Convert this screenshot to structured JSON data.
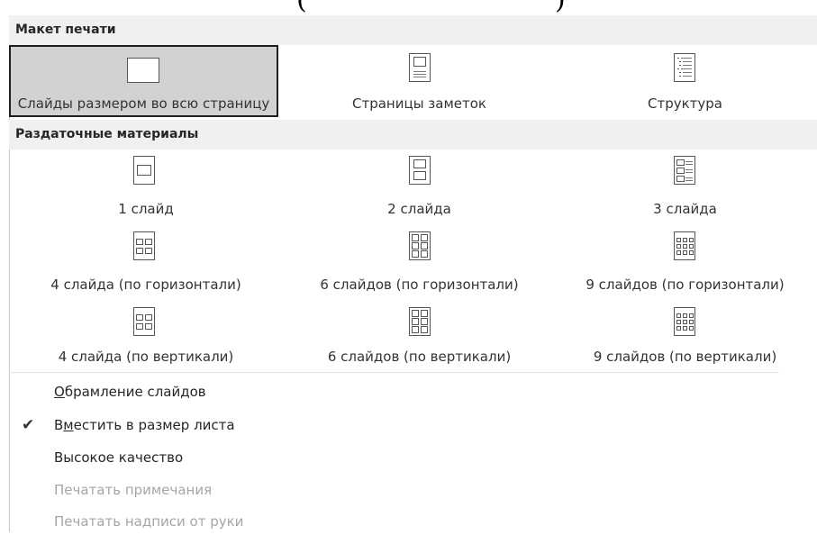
{
  "top_fragment": {
    "left_paren": "(",
    "right_paren": ")"
  },
  "print_layout": {
    "header": "Макет печати",
    "options": [
      {
        "label": "Слайды размером во всю страницу",
        "icon": "full-page-slide-icon",
        "selected": true
      },
      {
        "label": "Страницы заметок",
        "icon": "notes-page-icon",
        "selected": false
      },
      {
        "label": "Структура",
        "icon": "outline-icon",
        "selected": false
      }
    ]
  },
  "handouts": {
    "header": "Раздаточные материалы",
    "options": [
      {
        "label": "1 слайд",
        "icon": "handout-1-slide-icon"
      },
      {
        "label": "2 слайда",
        "icon": "handout-2-slides-icon"
      },
      {
        "label": "3 слайда",
        "icon": "handout-3-slides-icon"
      },
      {
        "label": "4 слайда (по горизонтали)",
        "icon": "handout-4-horizontal-icon"
      },
      {
        "label": "6 слайдов (по горизонтали)",
        "icon": "handout-6-horizontal-icon"
      },
      {
        "label": "9 слайдов (по горизонтали)",
        "icon": "handout-9-horizontal-icon"
      },
      {
        "label": "4 слайда (по вертикали)",
        "icon": "handout-4-vertical-icon"
      },
      {
        "label": "6 слайдов (по вертикали)",
        "icon": "handout-6-vertical-icon"
      },
      {
        "label": "9 слайдов (по вертикали)",
        "icon": "handout-9-vertical-icon"
      }
    ]
  },
  "menu": [
    {
      "label": "Обрамление слайдов",
      "accel_prefix": "",
      "accel": "О",
      "accel_suffix": "брамление слайдов",
      "checked": false,
      "enabled": true
    },
    {
      "label": "Вместить в размер листа",
      "accel_prefix": "В",
      "accel": "м",
      "accel_suffix": "естить в размер листа",
      "checked": true,
      "enabled": true
    },
    {
      "label": "Высокое качество",
      "checked": false,
      "enabled": true
    },
    {
      "label": "Печатать примечания",
      "checked": false,
      "enabled": false
    },
    {
      "label": "Печатать надписи от руки",
      "checked": false,
      "enabled": false
    }
  ],
  "checkmark": "✔",
  "colors": {
    "header_bg": "#f0f0f0",
    "selected_bg": "#d2d2d2",
    "selected_border": "#1f1f1f",
    "disabled_text": "#a6a6a6"
  }
}
